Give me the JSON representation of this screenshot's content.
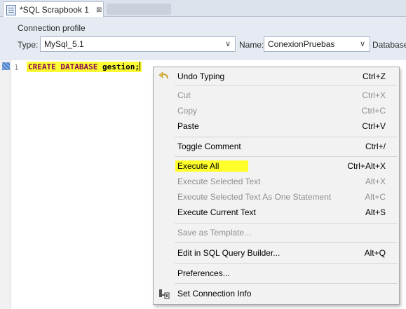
{
  "tab": {
    "title": "*SQL Scrapbook 1",
    "close_symbol": "⊠",
    "icon": "sql-file-icon"
  },
  "connection": {
    "heading": "Connection profile",
    "type_label": "Type:",
    "type_value": "MySql_5.1",
    "name_label": "Name:",
    "name_value": "ConexionPruebas",
    "database_label": "Database",
    "chevron": "∨"
  },
  "editor": {
    "line_number": "1",
    "code_keyword1": "CREATE",
    "code_keyword2": "DATABASE",
    "code_rest": "gestion;",
    "highlight_color": "#fcfc34"
  },
  "menu": {
    "items": [
      {
        "label": "Undo Typing",
        "shortcut": "Ctrl+Z",
        "enabled": true,
        "icon": "undo-icon"
      },
      {
        "label": "Cut",
        "shortcut": "Ctrl+X",
        "enabled": false
      },
      {
        "label": "Copy",
        "shortcut": "Ctrl+C",
        "enabled": false
      },
      {
        "label": "Paste",
        "shortcut": "Ctrl+V",
        "enabled": true
      },
      {
        "label": "Toggle Comment",
        "shortcut": "Ctrl+/",
        "enabled": true
      },
      {
        "label": "Execute All",
        "shortcut": "Ctrl+Alt+X",
        "enabled": true,
        "highlighted": true
      },
      {
        "label": "Execute Selected Text",
        "shortcut": "Alt+X",
        "enabled": false
      },
      {
        "label": "Execute Selected Text As One Statement",
        "shortcut": "Alt+C",
        "enabled": false
      },
      {
        "label": "Execute Current Text",
        "shortcut": "Alt+S",
        "enabled": true
      },
      {
        "label": "Save as Template...",
        "shortcut": "",
        "enabled": false
      },
      {
        "label": "Edit in SQL Query Builder...",
        "shortcut": "Alt+Q",
        "enabled": true
      },
      {
        "label": "Preferences...",
        "shortcut": "",
        "enabled": true
      },
      {
        "label": "Set Connection Info",
        "shortcut": "",
        "enabled": true,
        "icon": "connection-info-icon"
      }
    ]
  }
}
